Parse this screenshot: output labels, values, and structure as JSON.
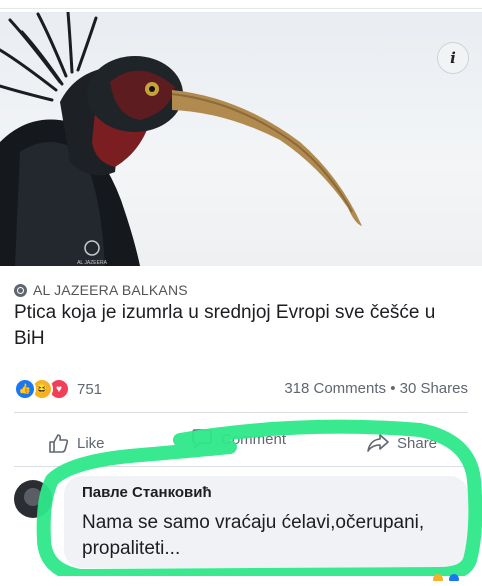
{
  "post": {
    "image_watermark": "AL JAZEERA",
    "info_icon": "info-icon",
    "source": "AL JAZEERA BALKANS",
    "headline": "Ptica koja je izumrla u srednjoj Evropi sve češće u BiH",
    "reactions_count": "751",
    "reactions_icons": [
      "like-icon",
      "haha-icon",
      "love-icon"
    ],
    "stats": "318 Comments • 30 Shares"
  },
  "actions": {
    "like": "Like",
    "comment": "Comment",
    "share": "Share"
  },
  "comment": {
    "author": "Павле Станковић",
    "text": "Nama se samo vraćaju ćelavi,očerupani, propaliteti..."
  },
  "colors": {
    "highlight_marker": "#2ee88a",
    "like_blue": "#1877f2"
  }
}
